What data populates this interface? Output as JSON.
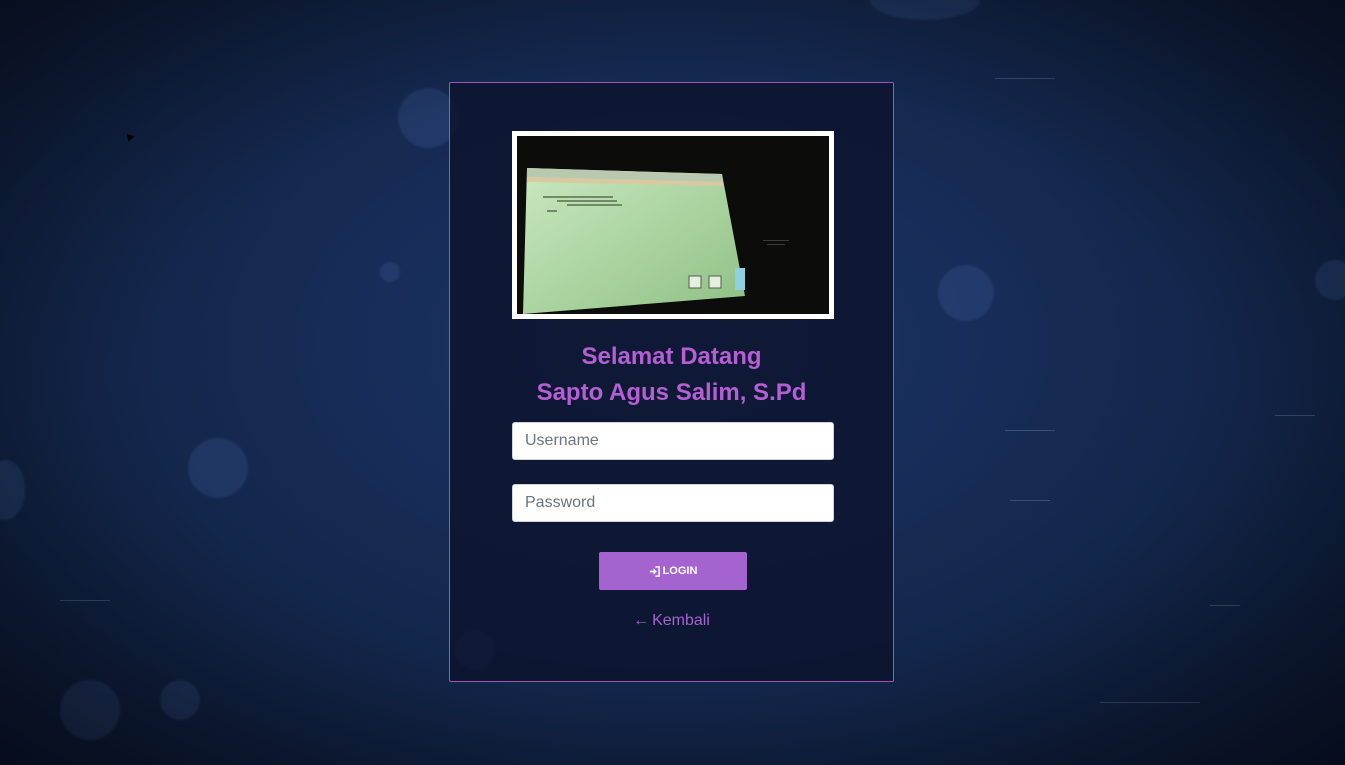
{
  "welcome": {
    "line1": "Selamat Datang",
    "line2": "Sapto Agus Salim, S.Pd"
  },
  "form": {
    "username_placeholder": "Username",
    "username_value": "",
    "password_placeholder": "Password",
    "password_value": ""
  },
  "login_button": {
    "icon": "sign-in-icon",
    "label": "LOGIN"
  },
  "back_link": {
    "icon": "arrow-left-icon",
    "label": "Kembali"
  },
  "colors": {
    "accent": "#a463cf",
    "title": "#b45fd3",
    "card_border": "#9b59b6",
    "background": "#172c57"
  }
}
